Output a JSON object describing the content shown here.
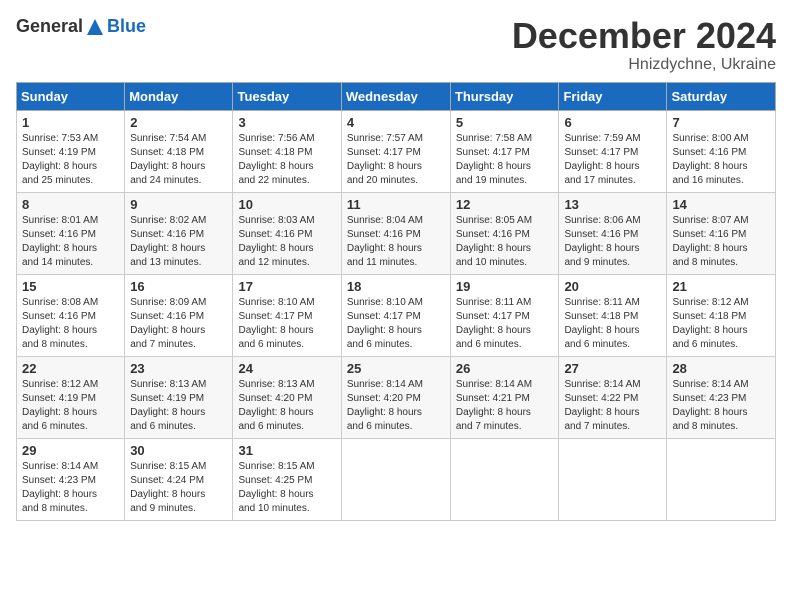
{
  "header": {
    "logo_general": "General",
    "logo_blue": "Blue",
    "month_title": "December 2024",
    "subtitle": "Hnizdychne, Ukraine"
  },
  "weekdays": [
    "Sunday",
    "Monday",
    "Tuesday",
    "Wednesday",
    "Thursday",
    "Friday",
    "Saturday"
  ],
  "weeks": [
    [
      {
        "day": "1",
        "lines": [
          "Sunrise: 7:53 AM",
          "Sunset: 4:19 PM",
          "Daylight: 8 hours",
          "and 25 minutes."
        ]
      },
      {
        "day": "2",
        "lines": [
          "Sunrise: 7:54 AM",
          "Sunset: 4:18 PM",
          "Daylight: 8 hours",
          "and 24 minutes."
        ]
      },
      {
        "day": "3",
        "lines": [
          "Sunrise: 7:56 AM",
          "Sunset: 4:18 PM",
          "Daylight: 8 hours",
          "and 22 minutes."
        ]
      },
      {
        "day": "4",
        "lines": [
          "Sunrise: 7:57 AM",
          "Sunset: 4:17 PM",
          "Daylight: 8 hours",
          "and 20 minutes."
        ]
      },
      {
        "day": "5",
        "lines": [
          "Sunrise: 7:58 AM",
          "Sunset: 4:17 PM",
          "Daylight: 8 hours",
          "and 19 minutes."
        ]
      },
      {
        "day": "6",
        "lines": [
          "Sunrise: 7:59 AM",
          "Sunset: 4:17 PM",
          "Daylight: 8 hours",
          "and 17 minutes."
        ]
      },
      {
        "day": "7",
        "lines": [
          "Sunrise: 8:00 AM",
          "Sunset: 4:16 PM",
          "Daylight: 8 hours",
          "and 16 minutes."
        ]
      }
    ],
    [
      {
        "day": "8",
        "lines": [
          "Sunrise: 8:01 AM",
          "Sunset: 4:16 PM",
          "Daylight: 8 hours",
          "and 14 minutes."
        ]
      },
      {
        "day": "9",
        "lines": [
          "Sunrise: 8:02 AM",
          "Sunset: 4:16 PM",
          "Daylight: 8 hours",
          "and 13 minutes."
        ]
      },
      {
        "day": "10",
        "lines": [
          "Sunrise: 8:03 AM",
          "Sunset: 4:16 PM",
          "Daylight: 8 hours",
          "and 12 minutes."
        ]
      },
      {
        "day": "11",
        "lines": [
          "Sunrise: 8:04 AM",
          "Sunset: 4:16 PM",
          "Daylight: 8 hours",
          "and 11 minutes."
        ]
      },
      {
        "day": "12",
        "lines": [
          "Sunrise: 8:05 AM",
          "Sunset: 4:16 PM",
          "Daylight: 8 hours",
          "and 10 minutes."
        ]
      },
      {
        "day": "13",
        "lines": [
          "Sunrise: 8:06 AM",
          "Sunset: 4:16 PM",
          "Daylight: 8 hours",
          "and 9 minutes."
        ]
      },
      {
        "day": "14",
        "lines": [
          "Sunrise: 8:07 AM",
          "Sunset: 4:16 PM",
          "Daylight: 8 hours",
          "and 8 minutes."
        ]
      }
    ],
    [
      {
        "day": "15",
        "lines": [
          "Sunrise: 8:08 AM",
          "Sunset: 4:16 PM",
          "Daylight: 8 hours",
          "and 8 minutes."
        ]
      },
      {
        "day": "16",
        "lines": [
          "Sunrise: 8:09 AM",
          "Sunset: 4:16 PM",
          "Daylight: 8 hours",
          "and 7 minutes."
        ]
      },
      {
        "day": "17",
        "lines": [
          "Sunrise: 8:10 AM",
          "Sunset: 4:17 PM",
          "Daylight: 8 hours",
          "and 6 minutes."
        ]
      },
      {
        "day": "18",
        "lines": [
          "Sunrise: 8:10 AM",
          "Sunset: 4:17 PM",
          "Daylight: 8 hours",
          "and 6 minutes."
        ]
      },
      {
        "day": "19",
        "lines": [
          "Sunrise: 8:11 AM",
          "Sunset: 4:17 PM",
          "Daylight: 8 hours",
          "and 6 minutes."
        ]
      },
      {
        "day": "20",
        "lines": [
          "Sunrise: 8:11 AM",
          "Sunset: 4:18 PM",
          "Daylight: 8 hours",
          "and 6 minutes."
        ]
      },
      {
        "day": "21",
        "lines": [
          "Sunrise: 8:12 AM",
          "Sunset: 4:18 PM",
          "Daylight: 8 hours",
          "and 6 minutes."
        ]
      }
    ],
    [
      {
        "day": "22",
        "lines": [
          "Sunrise: 8:12 AM",
          "Sunset: 4:19 PM",
          "Daylight: 8 hours",
          "and 6 minutes."
        ]
      },
      {
        "day": "23",
        "lines": [
          "Sunrise: 8:13 AM",
          "Sunset: 4:19 PM",
          "Daylight: 8 hours",
          "and 6 minutes."
        ]
      },
      {
        "day": "24",
        "lines": [
          "Sunrise: 8:13 AM",
          "Sunset: 4:20 PM",
          "Daylight: 8 hours",
          "and 6 minutes."
        ]
      },
      {
        "day": "25",
        "lines": [
          "Sunrise: 8:14 AM",
          "Sunset: 4:20 PM",
          "Daylight: 8 hours",
          "and 6 minutes."
        ]
      },
      {
        "day": "26",
        "lines": [
          "Sunrise: 8:14 AM",
          "Sunset: 4:21 PM",
          "Daylight: 8 hours",
          "and 7 minutes."
        ]
      },
      {
        "day": "27",
        "lines": [
          "Sunrise: 8:14 AM",
          "Sunset: 4:22 PM",
          "Daylight: 8 hours",
          "and 7 minutes."
        ]
      },
      {
        "day": "28",
        "lines": [
          "Sunrise: 8:14 AM",
          "Sunset: 4:23 PM",
          "Daylight: 8 hours",
          "and 8 minutes."
        ]
      }
    ],
    [
      {
        "day": "29",
        "lines": [
          "Sunrise: 8:14 AM",
          "Sunset: 4:23 PM",
          "Daylight: 8 hours",
          "and 8 minutes."
        ]
      },
      {
        "day": "30",
        "lines": [
          "Sunrise: 8:15 AM",
          "Sunset: 4:24 PM",
          "Daylight: 8 hours",
          "and 9 minutes."
        ]
      },
      {
        "day": "31",
        "lines": [
          "Sunrise: 8:15 AM",
          "Sunset: 4:25 PM",
          "Daylight: 8 hours",
          "and 10 minutes."
        ]
      },
      null,
      null,
      null,
      null
    ]
  ]
}
